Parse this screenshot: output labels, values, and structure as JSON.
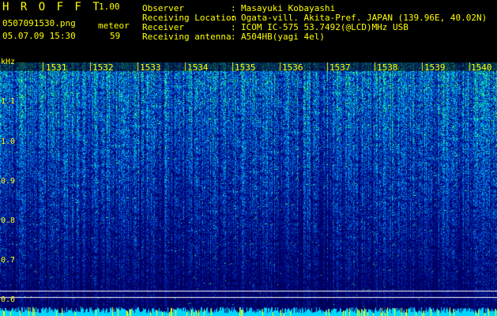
{
  "app": {
    "name": "H R O F F T",
    "version": "1.00"
  },
  "file": {
    "name": "0507091530.png",
    "datetime": "05.07.09 15:30"
  },
  "meteor": {
    "label": "meteor",
    "count": "59"
  },
  "info": [
    {
      "key": "Observer",
      "sep": ":",
      "value": "Masayuki Kobayashi"
    },
    {
      "key": "Receiving Location",
      "sep": ":",
      "value": "Ogata-vill. Akita-Pref. JAPAN (139.96E, 40.02N)"
    },
    {
      "key": "Receiver",
      "sep": ":",
      "value": "ICOM IC-575 53.7492(@LCD)MHz USB"
    },
    {
      "key": "Receiving antenna",
      "sep": ":",
      "value": "A504HB(yagi 4el)"
    }
  ],
  "spectrogram": {
    "freq_unit": "kHz",
    "freq_labels": [
      "1.1",
      "1.0",
      "0.9",
      "0.8",
      "0.7",
      "0.6"
    ],
    "time_labels": [
      "1531",
      "1532",
      "1533",
      "1534",
      "1535",
      "1536",
      "1537",
      "1538",
      "1539",
      "1540"
    ],
    "colors": {
      "label": "#ffff00",
      "noise_low": "#00007a",
      "noise_high": "#00c8ff",
      "signal": "#00ff80",
      "line": "#ffffff"
    }
  }
}
